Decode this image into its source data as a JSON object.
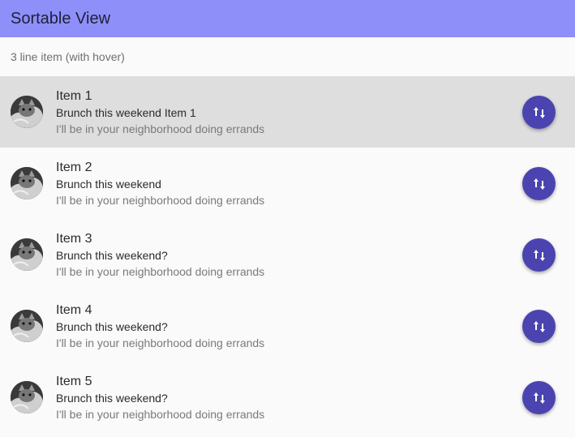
{
  "toolbar": {
    "title": "Sortable View"
  },
  "subheader": {
    "text": "3 line item (with hover)"
  },
  "list": {
    "items": [
      {
        "title": "Item 1",
        "subtitle": "Brunch this weekend Item 1",
        "detail": "I'll be in your neighborhood doing errands",
        "hovered": true
      },
      {
        "title": "Item 2",
        "subtitle": "Brunch this weekend",
        "detail": "I'll be in your neighborhood doing errands",
        "hovered": false
      },
      {
        "title": "Item 3",
        "subtitle": "Brunch this weekend?",
        "detail": "I'll be in your neighborhood doing errands",
        "hovered": false
      },
      {
        "title": "Item 4",
        "subtitle": "Brunch this weekend?",
        "detail": "I'll be in your neighborhood doing errands",
        "hovered": false
      },
      {
        "title": "Item 5",
        "subtitle": "Brunch this weekend?",
        "detail": "I'll be in your neighborhood doing errands",
        "hovered": false
      }
    ],
    "action_icon": "swap-vert-icon",
    "avatar_icon": "cat-avatar"
  },
  "colors": {
    "toolbar": "#8f8ffa",
    "accent": "#4b44b0",
    "hover": "#dedede"
  }
}
